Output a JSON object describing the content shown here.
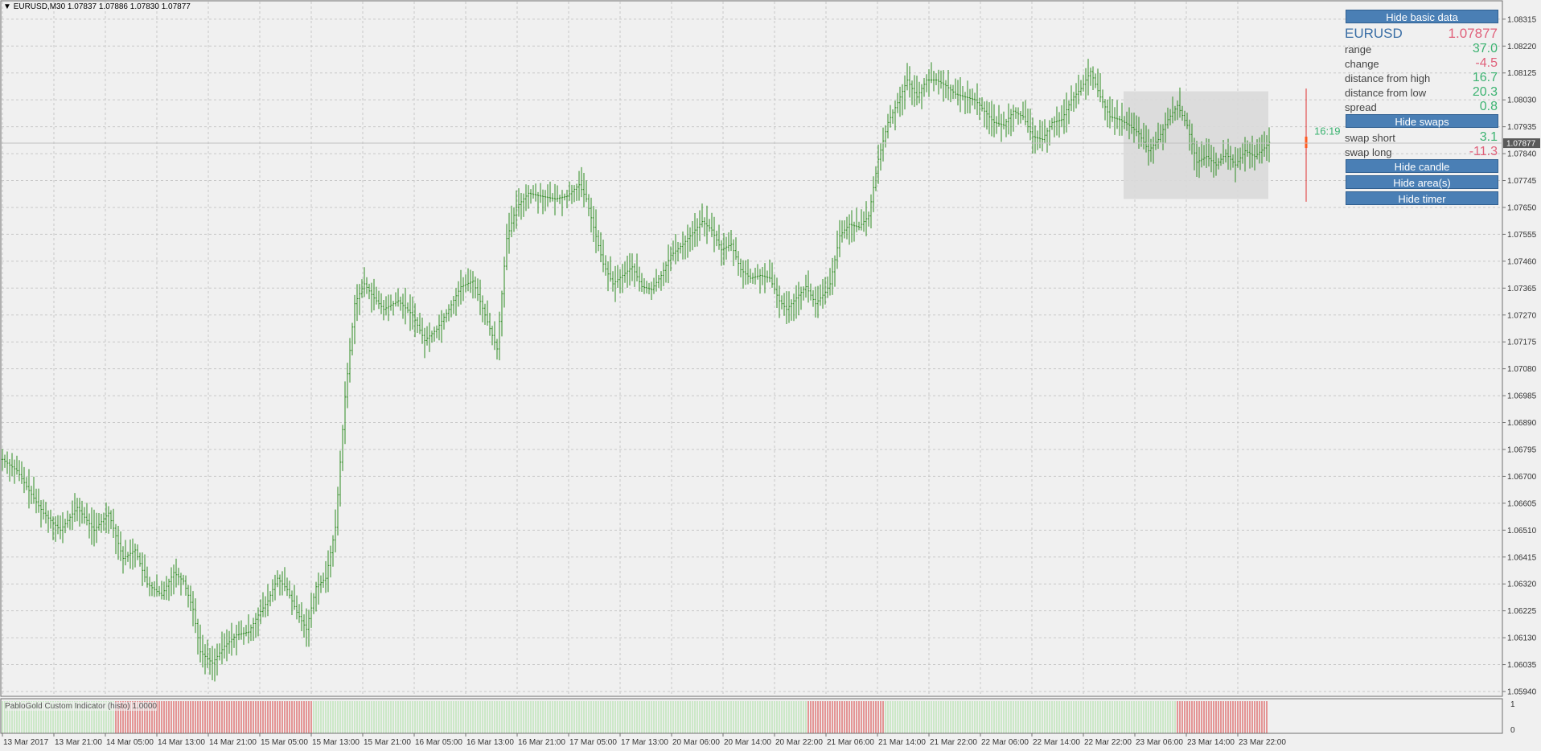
{
  "header": {
    "symbol_info": "EURUSD,M30  1.07837 1.07886 1.07830 1.07877"
  },
  "panel": {
    "hide_basic_label": "Hide basic data",
    "symbol": "EURUSD",
    "price": "1.07877",
    "rows": [
      {
        "label": "range",
        "value": "37.0",
        "color": "#3cb371"
      },
      {
        "label": "change",
        "value": "-4.5",
        "color": "#e0607a"
      },
      {
        "label": "distance from high",
        "value": "16.7",
        "color": "#3cb371"
      },
      {
        "label": "distance from low",
        "value": "20.3",
        "color": "#3cb371"
      },
      {
        "label": "spread",
        "value": "0.8",
        "color": "#3cb371"
      }
    ],
    "hide_swaps_label": "Hide swaps",
    "swaps": [
      {
        "label": "swap short",
        "value": "3.1",
        "color": "#3cb371"
      },
      {
        "label": "swap long",
        "value": "-11.3",
        "color": "#e0607a"
      }
    ],
    "hide_candle_label": "Hide candle",
    "hide_area_label": "Hide area(s)",
    "hide_timer_label": "Hide timer"
  },
  "timer": "16:19",
  "current_price_label": "1.07877",
  "price_axis": [
    "1.08315",
    "1.08220",
    "1.08125",
    "1.08030",
    "1.07935",
    "1.07840",
    "1.07745",
    "1.07650",
    "1.07555",
    "1.07460",
    "1.07365",
    "1.07270",
    "1.07175",
    "1.07080",
    "1.06985",
    "1.06890",
    "1.06795",
    "1.06700",
    "1.06605",
    "1.06510",
    "1.06415",
    "1.06320",
    "1.06225",
    "1.06130",
    "1.06035",
    "1.05940"
  ],
  "time_axis": [
    "13 Mar 2017",
    "13 Mar 21:00",
    "14 Mar 05:00",
    "14 Mar 13:00",
    "14 Mar 21:00",
    "15 Mar 05:00",
    "15 Mar 13:00",
    "15 Mar 21:00",
    "16 Mar 05:00",
    "16 Mar 13:00",
    "16 Mar 21:00",
    "17 Mar 05:00",
    "17 Mar 13:00",
    "20 Mar 06:00",
    "20 Mar 14:00",
    "20 Mar 22:00",
    "21 Mar 06:00",
    "21 Mar 14:00",
    "21 Mar 22:00",
    "22 Mar 06:00",
    "22 Mar 14:00",
    "22 Mar 22:00",
    "23 Mar 06:00",
    "23 Mar 14:00",
    "23 Mar 22:00"
  ],
  "indicator": {
    "label": "PabloGold Custom Indicator (histo) 1.0000",
    "axis_top": "1",
    "axis_bottom": "0"
  },
  "colors": {
    "bar": "#2e8b22",
    "hist_green": "#a8e0a0",
    "hist_red": "#d83a3a",
    "button": "#4a7fb5",
    "area": "#d9d9d9",
    "candle": "#ff5a1f"
  },
  "chart_data": {
    "type": "ohlc",
    "title": "EURUSD,M30",
    "ylim": [
      1.0594,
      1.0836
    ],
    "anchors": [
      [
        0,
        1.0676
      ],
      [
        6,
        1.0672
      ],
      [
        11,
        1.0665
      ],
      [
        17,
        1.0657
      ],
      [
        24,
        1.0651
      ],
      [
        31,
        1.0659
      ],
      [
        38,
        1.0651
      ],
      [
        44,
        1.0657
      ],
      [
        50,
        1.0641
      ],
      [
        55,
        1.0644
      ],
      [
        60,
        1.0632
      ],
      [
        66,
        1.0628
      ],
      [
        71,
        1.0636
      ],
      [
        75,
        1.0633
      ],
      [
        79,
        1.0623
      ],
      [
        82,
        1.0608
      ],
      [
        87,
        1.0604
      ],
      [
        92,
        1.061
      ],
      [
        97,
        1.0614
      ],
      [
        102,
        1.0615
      ],
      [
        106,
        1.0621
      ],
      [
        110,
        1.0626
      ],
      [
        114,
        1.0634
      ],
      [
        118,
        1.063
      ],
      [
        122,
        1.0622
      ],
      [
        126,
        1.0616
      ],
      [
        130,
        1.0631
      ],
      [
        134,
        1.0634
      ],
      [
        138,
        1.0652
      ],
      [
        142,
        1.0698
      ],
      [
        146,
        1.0731
      ],
      [
        150,
        1.0738
      ],
      [
        154,
        1.0733
      ],
      [
        158,
        1.0729
      ],
      [
        164,
        1.0732
      ],
      [
        170,
        1.0727
      ],
      [
        175,
        1.0718
      ],
      [
        180,
        1.0722
      ],
      [
        185,
        1.0729
      ],
      [
        190,
        1.0737
      ],
      [
        195,
        1.0739
      ],
      [
        200,
        1.0727
      ],
      [
        205,
        1.0715
      ],
      [
        209,
        1.0754
      ],
      [
        213,
        1.0765
      ],
      [
        218,
        1.077
      ],
      [
        223,
        1.0769
      ],
      [
        229,
        1.0768
      ],
      [
        234,
        1.0769
      ],
      [
        239,
        1.0773
      ],
      [
        242,
        1.0768
      ],
      [
        245,
        1.0758
      ],
      [
        249,
        1.0745
      ],
      [
        253,
        1.0738
      ],
      [
        257,
        1.0741
      ],
      [
        261,
        1.0744
      ],
      [
        265,
        1.0737
      ],
      [
        269,
        1.0736
      ],
      [
        273,
        1.0741
      ],
      [
        277,
        1.0748
      ],
      [
        282,
        1.0752
      ],
      [
        286,
        1.0756
      ],
      [
        290,
        1.076
      ],
      [
        294,
        1.0757
      ],
      [
        298,
        1.075
      ],
      [
        302,
        1.0752
      ],
      [
        306,
        1.0743
      ],
      [
        310,
        1.074
      ],
      [
        314,
        1.0741
      ],
      [
        318,
        1.074
      ],
      [
        322,
        1.0732
      ],
      [
        325,
        1.0729
      ],
      [
        329,
        1.0733
      ],
      [
        333,
        1.0737
      ],
      [
        337,
        1.0731
      ],
      [
        341,
        1.0735
      ],
      [
        343,
        1.0738
      ],
      [
        347,
        1.0755
      ],
      [
        351,
        1.0759
      ],
      [
        355,
        1.0758
      ],
      [
        359,
        1.0762
      ],
      [
        363,
        1.0782
      ],
      [
        367,
        1.0795
      ],
      [
        371,
        1.0802
      ],
      [
        375,
        1.081
      ],
      [
        379,
        1.0804
      ],
      [
        383,
        1.081
      ],
      [
        387,
        1.081
      ],
      [
        391,
        1.0808
      ],
      [
        395,
        1.0805
      ],
      [
        399,
        1.0804
      ],
      [
        403,
        1.0803
      ],
      [
        407,
        1.0799
      ],
      [
        411,
        1.0795
      ],
      [
        415,
        1.0794
      ],
      [
        419,
        1.0799
      ],
      [
        423,
        1.0797
      ],
      [
        427,
        1.079
      ],
      [
        431,
        1.0789
      ],
      [
        435,
        1.0795
      ],
      [
        439,
        1.0796
      ],
      [
        443,
        1.0803
      ],
      [
        447,
        1.0807
      ],
      [
        451,
        1.0813
      ],
      [
        455,
        1.0804
      ],
      [
        459,
        1.0797
      ],
      [
        463,
        1.0796
      ],
      [
        467,
        1.0794
      ],
      [
        471,
        1.0791
      ],
      [
        475,
        1.0785
      ],
      [
        479,
        1.0789
      ],
      [
        483,
        1.0796
      ],
      [
        487,
        1.0801
      ],
      [
        491,
        1.0794
      ],
      [
        495,
        1.0781
      ],
      [
        499,
        1.0783
      ],
      [
        503,
        1.078
      ],
      [
        507,
        1.0784
      ],
      [
        511,
        1.078
      ],
      [
        515,
        1.0785
      ],
      [
        519,
        1.0783
      ],
      [
        523,
        1.0786
      ],
      [
        525,
        1.0788
      ]
    ],
    "hist_segments": [
      {
        "from": 0,
        "to": 47,
        "color": "green"
      },
      {
        "from": 47,
        "to": 129,
        "color": "red"
      },
      {
        "from": 129,
        "to": 334,
        "color": "green"
      },
      {
        "from": 334,
        "to": 366,
        "color": "red"
      },
      {
        "from": 366,
        "to": 487,
        "color": "green"
      },
      {
        "from": 487,
        "to": 525,
        "color": "red"
      }
    ]
  }
}
